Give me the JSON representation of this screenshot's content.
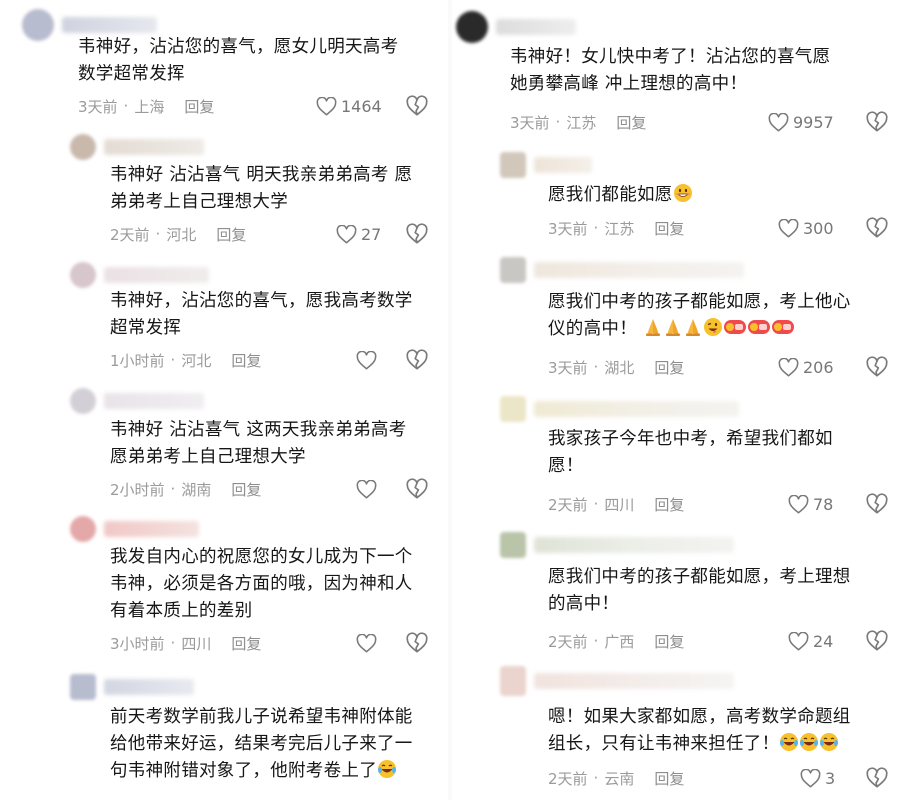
{
  "colors": {
    "text": "#161616",
    "meta": "#9b9b9b",
    "icon": "#777777",
    "background": "#ffffff"
  },
  "icons": {
    "like": "heart-outline-icon",
    "dislike": "broken-heart-icon",
    "emoji_grin": "grinning-face-emoji",
    "emoji_laugh": "tears-of-joy-emoji",
    "emoji_pray": "praying-hands-emoji",
    "emoji_wink": "winking-face-emoji"
  },
  "left": [
    {
      "line1": "韦神好，沾沾您的喜气，愿女儿明天高考",
      "line2": "数学超常发挥",
      "line3": "",
      "time": "3天前",
      "loc": "上海",
      "reply": "回复",
      "likes": "1464"
    },
    {
      "line1": "韦神好 沾沾喜气 明天我亲弟弟高考 愿",
      "line2": "弟弟考上自己理想大学",
      "line3": "",
      "time": "2天前",
      "loc": "河北",
      "reply": "回复",
      "likes": "27"
    },
    {
      "line1": "韦神好，沾沾您的喜气，愿我高考数学",
      "line2": "超常发挥",
      "line3": "",
      "time": "1小时前",
      "loc": "河北",
      "reply": "回复",
      "likes": ""
    },
    {
      "line1": "韦神好 沾沾喜气 这两天我亲弟弟高考",
      "line2": "愿弟弟考上自己理想大学",
      "line3": "",
      "time": "2小时前",
      "loc": "湖南",
      "reply": "回复",
      "likes": ""
    },
    {
      "line1": "我发自内心的祝愿您的女儿成为下一个",
      "line2": "韦神，必须是各方面的哦，因为神和人",
      "line3": "有着本质上的差别",
      "time": "3小时前",
      "loc": "四川",
      "reply": "回复",
      "likes": ""
    },
    {
      "line1": "前天考数学前我儿子说希望韦神附体能",
      "line2": "给他带来好运，结果考完后儿子来了一",
      "line3": "句韦神附错对象了，他附考卷上了",
      "time": "",
      "loc": "",
      "reply": "",
      "likes": ""
    }
  ],
  "right": [
    {
      "line1": "韦神好！女儿快中考了！沾沾您的喜气愿",
      "line2": "她勇攀高峰 冲上理想的高中！",
      "time": "3天前",
      "loc": "江苏",
      "reply": "回复",
      "likes": "9957"
    },
    {
      "line1": "愿我们都能如愿",
      "line2": "",
      "time": "3天前",
      "loc": "江苏",
      "reply": "回复",
      "likes": "300"
    },
    {
      "line1": "愿我们中考的孩子都能如愿，考上他心",
      "line2": "仪的高中！",
      "time": "3天前",
      "loc": "湖北",
      "reply": "回复",
      "likes": "206"
    },
    {
      "line1": "我家孩子今年也中考，希望我们都如",
      "line2": "愿！",
      "time": "2天前",
      "loc": "四川",
      "reply": "回复",
      "likes": "78"
    },
    {
      "line1": "愿我们中考的孩子都能如愿，考上理想",
      "line2": "的高中！",
      "time": "2天前",
      "loc": "广西",
      "reply": "回复",
      "likes": "24"
    },
    {
      "line1": "嗯！如果大家都如愿，高考数学命题组",
      "line2": "组长，只有让韦神来担任了！",
      "time": "2天前",
      "loc": "云南",
      "reply": "回复",
      "likes": "3"
    }
  ]
}
